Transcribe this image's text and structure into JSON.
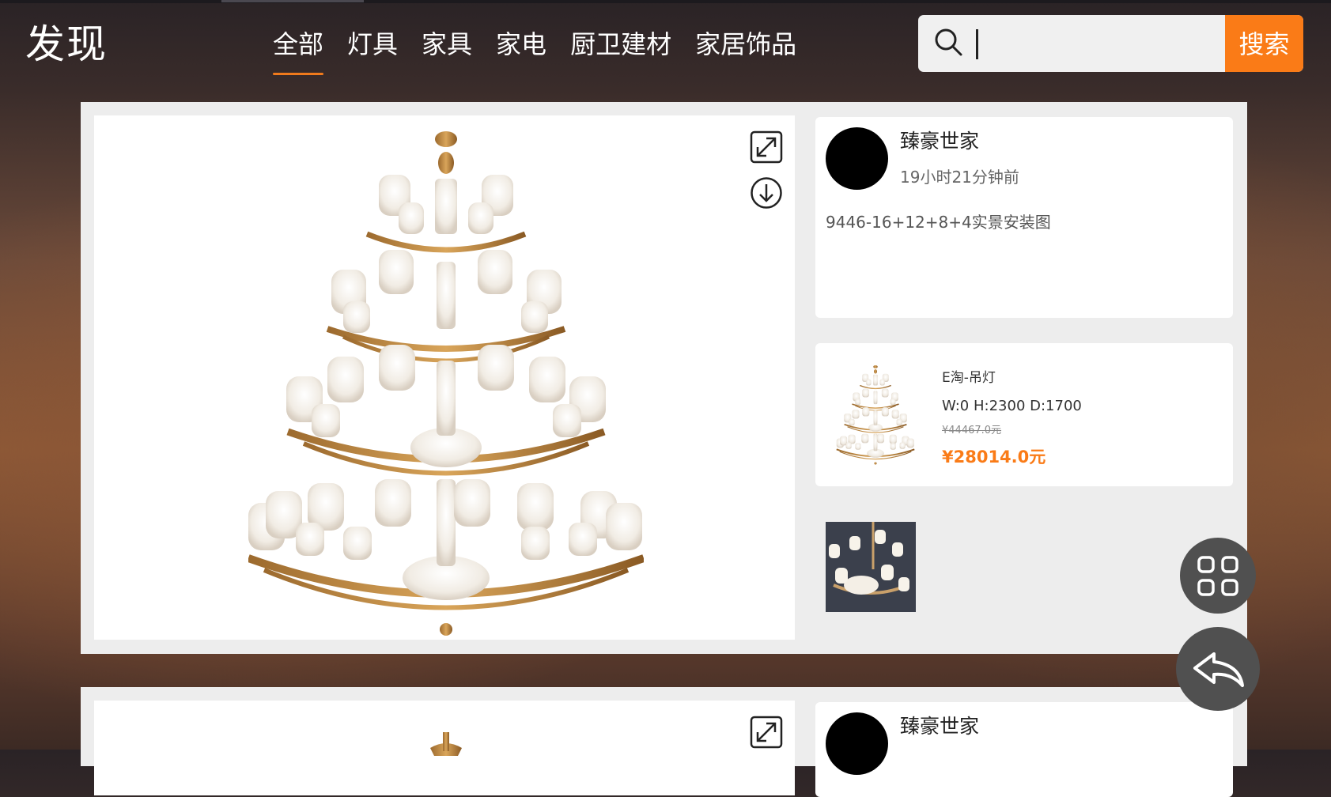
{
  "header": {
    "title": "发现",
    "tabs": [
      {
        "label": "全部",
        "active": true
      },
      {
        "label": "灯具",
        "active": false
      },
      {
        "label": "家具",
        "active": false
      },
      {
        "label": "家电",
        "active": false
      },
      {
        "label": "厨卫建材",
        "active": false
      },
      {
        "label": "家居饰品",
        "active": false
      }
    ],
    "search": {
      "value": "",
      "placeholder": "",
      "button_label": "搜索"
    }
  },
  "posts": [
    {
      "author": "臻豪世家",
      "time": "19小时21分钟前",
      "description": "9446-16+12+8+4实景安装图",
      "product": {
        "name": "E淘-吊灯",
        "dimensions": "W:0 H:2300 D:1700",
        "original_price": "¥44467.0元",
        "price": "¥28014.0元"
      }
    },
    {
      "author": "臻豪世家"
    }
  ],
  "icons": {
    "expand": "expand-icon",
    "download": "download-icon",
    "search": "search-icon",
    "grid": "grid-icon",
    "back": "back-arrow-icon"
  },
  "colors": {
    "accent": "#fa7b17",
    "floating_button": "#505050"
  }
}
